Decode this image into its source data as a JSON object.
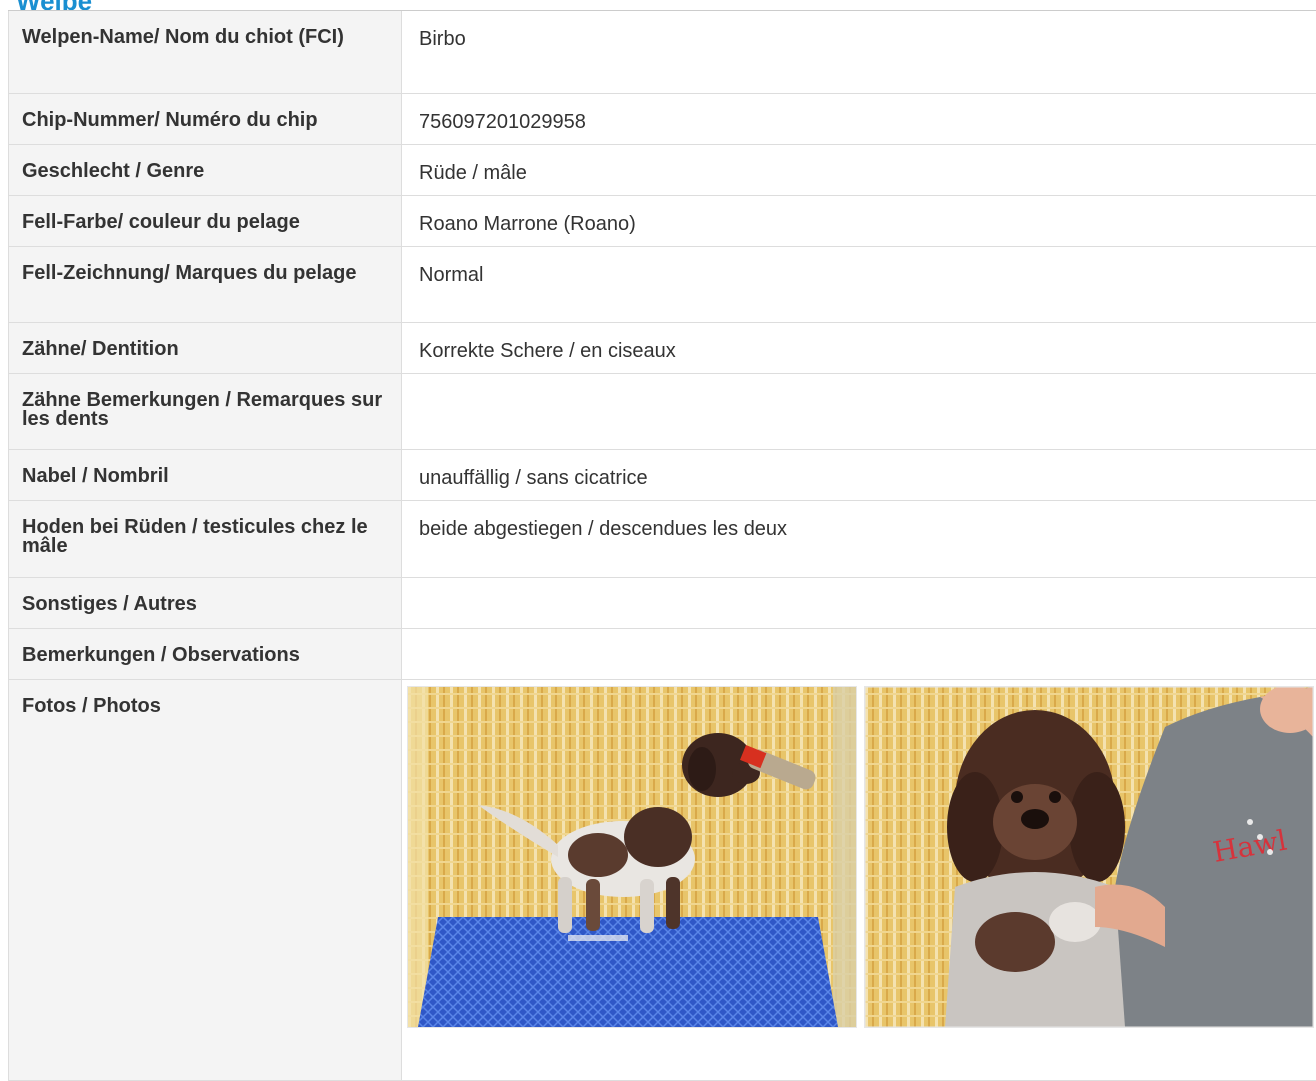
{
  "section_title": "Welpe",
  "rows": [
    {
      "label": "Welpen-Name/ Nom du chiot (FCI)",
      "value": "Birbo"
    },
    {
      "label": "Chip-Nummer/ Numéro du chip",
      "value": "756097201029958"
    },
    {
      "label": "Geschlecht / Genre",
      "value": "Rüde / mâle"
    },
    {
      "label": "Fell-Farbe/ couleur du pelage",
      "value": "Roano Marrone (Roano)"
    },
    {
      "label": "Fell-Zeichnung/ Marques du pelage",
      "value": "Normal"
    },
    {
      "label": "Zähne/ Dentition",
      "value": "Korrekte Schere / en ciseaux"
    },
    {
      "label": "Zähne Bemerkungen / Remarques sur les dents",
      "value": ""
    },
    {
      "label": "Nabel / Nombril",
      "value": "unauffällig / sans cicatrice"
    },
    {
      "label": "Hoden bei Rüden / testicules chez le mâle",
      "value": "beide abgestiegen / descendues les deux"
    },
    {
      "label": "Sonstiges / Autres",
      "value": ""
    },
    {
      "label": "Bemerkungen / Observations",
      "value": ""
    },
    {
      "label": "Fotos / Photos",
      "value": ""
    }
  ],
  "photos": [
    {
      "icon": "puppy-standing-photo"
    },
    {
      "icon": "puppy-held-photo"
    }
  ],
  "colors": {
    "title": "#1a8fd1",
    "label_bg": "#f4f4f4",
    "border": "#dddddd"
  }
}
